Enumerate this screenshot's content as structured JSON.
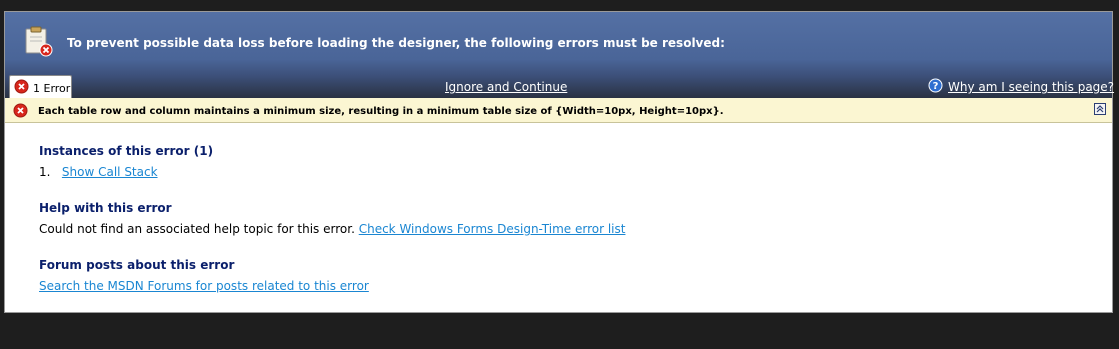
{
  "header": {
    "title": "To prevent possible data loss before loading the designer, the following errors must be resolved:",
    "icon": "clipboard-error-icon"
  },
  "tabs": [
    {
      "label": "1 Error",
      "icon": "error-icon"
    }
  ],
  "actions": {
    "ignore_label": "Ignore and Continue",
    "why_label": "Why am I seeing this page?"
  },
  "error": {
    "message": "Each table row and column maintains a minimum size, resulting in a minimum table size of {Width=10px, Height=10px}."
  },
  "instances": {
    "heading": "Instances of this error (1)",
    "items": [
      {
        "number": "1.",
        "link": "Show Call Stack"
      }
    ]
  },
  "help": {
    "heading": "Help with this error",
    "text": "Could not find an associated help topic for this error.",
    "link": "Check Windows Forms Design-Time error list"
  },
  "forum": {
    "heading": "Forum posts about this error",
    "link": "Search the MSDN Forums for posts related to this error"
  },
  "colors": {
    "header_blue": "#4a6598",
    "link_blue": "#1a86d2",
    "heading_navy": "#0a1f6b",
    "error_bar": "#fbf6d2",
    "error_red": "#d8261c"
  }
}
